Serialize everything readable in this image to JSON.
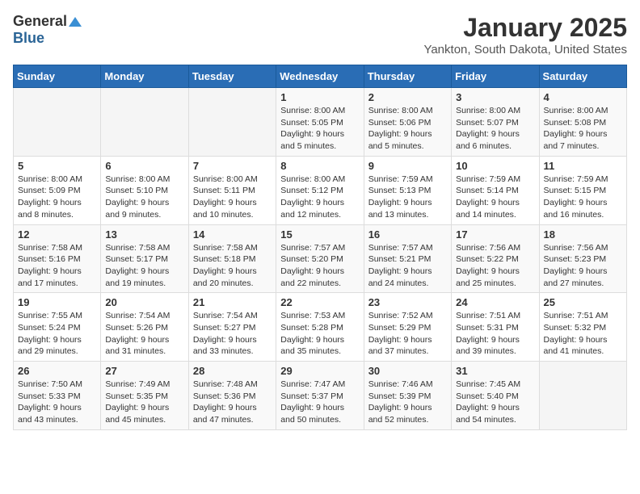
{
  "logo": {
    "general": "General",
    "blue": "Blue"
  },
  "header": {
    "title": "January 2025",
    "location": "Yankton, South Dakota, United States"
  },
  "weekdays": [
    "Sunday",
    "Monday",
    "Tuesday",
    "Wednesday",
    "Thursday",
    "Friday",
    "Saturday"
  ],
  "weeks": [
    [
      {
        "day": "",
        "info": ""
      },
      {
        "day": "",
        "info": ""
      },
      {
        "day": "",
        "info": ""
      },
      {
        "day": "1",
        "info": "Sunrise: 8:00 AM\nSunset: 5:05 PM\nDaylight: 9 hours\nand 5 minutes."
      },
      {
        "day": "2",
        "info": "Sunrise: 8:00 AM\nSunset: 5:06 PM\nDaylight: 9 hours\nand 5 minutes."
      },
      {
        "day": "3",
        "info": "Sunrise: 8:00 AM\nSunset: 5:07 PM\nDaylight: 9 hours\nand 6 minutes."
      },
      {
        "day": "4",
        "info": "Sunrise: 8:00 AM\nSunset: 5:08 PM\nDaylight: 9 hours\nand 7 minutes."
      }
    ],
    [
      {
        "day": "5",
        "info": "Sunrise: 8:00 AM\nSunset: 5:09 PM\nDaylight: 9 hours\nand 8 minutes."
      },
      {
        "day": "6",
        "info": "Sunrise: 8:00 AM\nSunset: 5:10 PM\nDaylight: 9 hours\nand 9 minutes."
      },
      {
        "day": "7",
        "info": "Sunrise: 8:00 AM\nSunset: 5:11 PM\nDaylight: 9 hours\nand 10 minutes."
      },
      {
        "day": "8",
        "info": "Sunrise: 8:00 AM\nSunset: 5:12 PM\nDaylight: 9 hours\nand 12 minutes."
      },
      {
        "day": "9",
        "info": "Sunrise: 7:59 AM\nSunset: 5:13 PM\nDaylight: 9 hours\nand 13 minutes."
      },
      {
        "day": "10",
        "info": "Sunrise: 7:59 AM\nSunset: 5:14 PM\nDaylight: 9 hours\nand 14 minutes."
      },
      {
        "day": "11",
        "info": "Sunrise: 7:59 AM\nSunset: 5:15 PM\nDaylight: 9 hours\nand 16 minutes."
      }
    ],
    [
      {
        "day": "12",
        "info": "Sunrise: 7:58 AM\nSunset: 5:16 PM\nDaylight: 9 hours\nand 17 minutes."
      },
      {
        "day": "13",
        "info": "Sunrise: 7:58 AM\nSunset: 5:17 PM\nDaylight: 9 hours\nand 19 minutes."
      },
      {
        "day": "14",
        "info": "Sunrise: 7:58 AM\nSunset: 5:18 PM\nDaylight: 9 hours\nand 20 minutes."
      },
      {
        "day": "15",
        "info": "Sunrise: 7:57 AM\nSunset: 5:20 PM\nDaylight: 9 hours\nand 22 minutes."
      },
      {
        "day": "16",
        "info": "Sunrise: 7:57 AM\nSunset: 5:21 PM\nDaylight: 9 hours\nand 24 minutes."
      },
      {
        "day": "17",
        "info": "Sunrise: 7:56 AM\nSunset: 5:22 PM\nDaylight: 9 hours\nand 25 minutes."
      },
      {
        "day": "18",
        "info": "Sunrise: 7:56 AM\nSunset: 5:23 PM\nDaylight: 9 hours\nand 27 minutes."
      }
    ],
    [
      {
        "day": "19",
        "info": "Sunrise: 7:55 AM\nSunset: 5:24 PM\nDaylight: 9 hours\nand 29 minutes."
      },
      {
        "day": "20",
        "info": "Sunrise: 7:54 AM\nSunset: 5:26 PM\nDaylight: 9 hours\nand 31 minutes."
      },
      {
        "day": "21",
        "info": "Sunrise: 7:54 AM\nSunset: 5:27 PM\nDaylight: 9 hours\nand 33 minutes."
      },
      {
        "day": "22",
        "info": "Sunrise: 7:53 AM\nSunset: 5:28 PM\nDaylight: 9 hours\nand 35 minutes."
      },
      {
        "day": "23",
        "info": "Sunrise: 7:52 AM\nSunset: 5:29 PM\nDaylight: 9 hours\nand 37 minutes."
      },
      {
        "day": "24",
        "info": "Sunrise: 7:51 AM\nSunset: 5:31 PM\nDaylight: 9 hours\nand 39 minutes."
      },
      {
        "day": "25",
        "info": "Sunrise: 7:51 AM\nSunset: 5:32 PM\nDaylight: 9 hours\nand 41 minutes."
      }
    ],
    [
      {
        "day": "26",
        "info": "Sunrise: 7:50 AM\nSunset: 5:33 PM\nDaylight: 9 hours\nand 43 minutes."
      },
      {
        "day": "27",
        "info": "Sunrise: 7:49 AM\nSunset: 5:35 PM\nDaylight: 9 hours\nand 45 minutes."
      },
      {
        "day": "28",
        "info": "Sunrise: 7:48 AM\nSunset: 5:36 PM\nDaylight: 9 hours\nand 47 minutes."
      },
      {
        "day": "29",
        "info": "Sunrise: 7:47 AM\nSunset: 5:37 PM\nDaylight: 9 hours\nand 50 minutes."
      },
      {
        "day": "30",
        "info": "Sunrise: 7:46 AM\nSunset: 5:39 PM\nDaylight: 9 hours\nand 52 minutes."
      },
      {
        "day": "31",
        "info": "Sunrise: 7:45 AM\nSunset: 5:40 PM\nDaylight: 9 hours\nand 54 minutes."
      },
      {
        "day": "",
        "info": ""
      }
    ]
  ]
}
